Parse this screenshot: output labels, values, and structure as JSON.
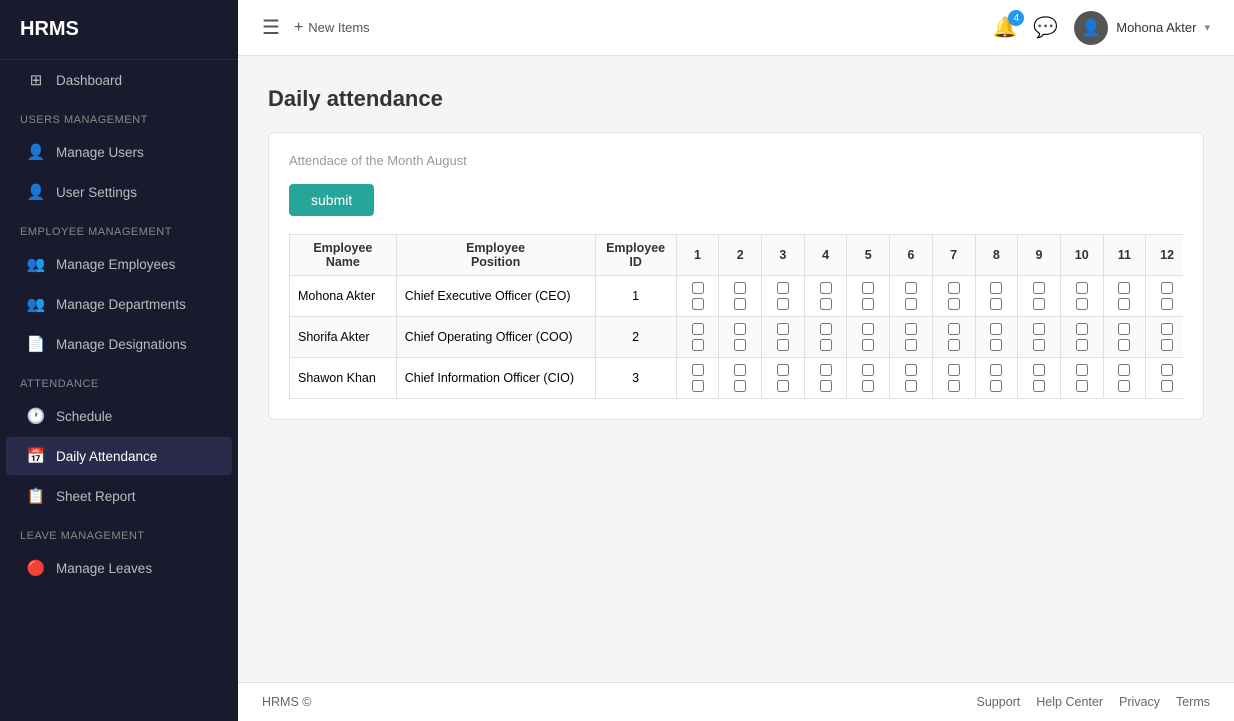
{
  "sidebar": {
    "logo": "HRMS",
    "items": [
      {
        "id": "dashboard",
        "label": "Dashboard",
        "icon": "⊞",
        "section": null
      },
      {
        "id": "users-mgmt-label",
        "label": "Users Management",
        "section": true
      },
      {
        "id": "manage-users",
        "label": "Manage Users",
        "icon": "👤"
      },
      {
        "id": "user-settings",
        "label": "User Settings",
        "icon": "👤"
      },
      {
        "id": "employee-mgmt-label",
        "label": "Employee Management",
        "section": true
      },
      {
        "id": "manage-employees",
        "label": "Manage Employees",
        "icon": "👥"
      },
      {
        "id": "manage-departments",
        "label": "Manage Departments",
        "icon": "👥"
      },
      {
        "id": "manage-designations",
        "label": "Manage Designations",
        "icon": "📄"
      },
      {
        "id": "attendance-label",
        "label": "Attendance",
        "section": true
      },
      {
        "id": "schedule",
        "label": "Schedule",
        "icon": "🕐"
      },
      {
        "id": "daily-attendance",
        "label": "Daily Attendance",
        "icon": "📅",
        "active": true
      },
      {
        "id": "sheet-report",
        "label": "Sheet Report",
        "icon": "📋"
      },
      {
        "id": "leave-mgmt-label",
        "label": "Leave Management",
        "section": true
      },
      {
        "id": "manage-leaves",
        "label": "Manage Leaves",
        "icon": "🔴"
      }
    ]
  },
  "topbar": {
    "menu_icon": "☰",
    "new_items_label": "New Items",
    "notif_count": "4",
    "user_name": "Mohona Akter",
    "user_icon": "👤"
  },
  "page": {
    "title": "Daily attendance",
    "card_subtitle": "Attendace of the Month August",
    "submit_label": "submit"
  },
  "table": {
    "headers": [
      "Employee Name",
      "Employee Position",
      "Employee ID",
      "1",
      "2",
      "3",
      "4",
      "5",
      "6",
      "7",
      "8",
      "9",
      "10",
      "11",
      "12"
    ],
    "rows": [
      {
        "name": "Mohona Akter",
        "position": "Chief Executive Officer (CEO)",
        "id": "1"
      },
      {
        "name": "Shorifa Akter",
        "position": "Chief Operating Officer (COO)",
        "id": "2"
      },
      {
        "name": "Shawon Khan",
        "position": "Chief Information Officer (CIO)",
        "id": "3"
      }
    ]
  },
  "footer": {
    "copyright": "HRMS ©",
    "links": [
      "Support",
      "Help Center",
      "Privacy",
      "Terms"
    ]
  }
}
